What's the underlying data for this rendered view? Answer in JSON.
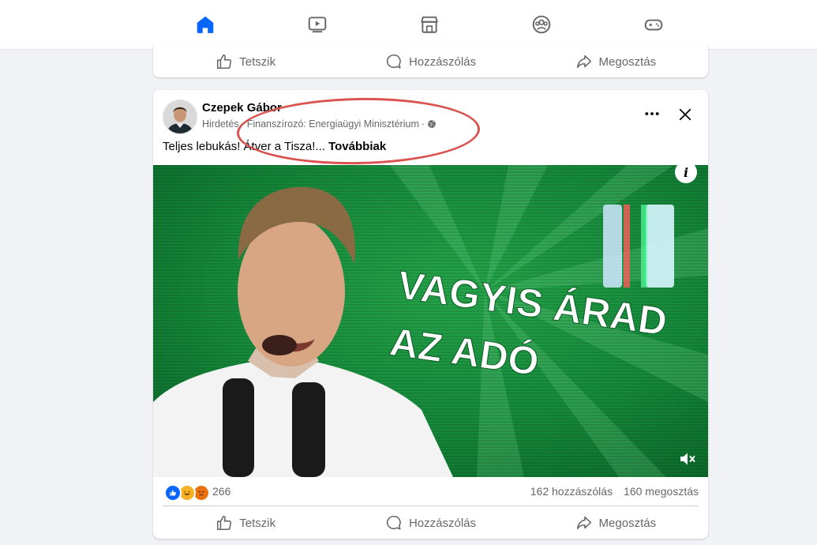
{
  "nav": {
    "tabs": [
      {
        "name": "home-icon",
        "active": true
      },
      {
        "name": "video-icon",
        "active": false
      },
      {
        "name": "marketplace-icon",
        "active": false
      },
      {
        "name": "groups-icon",
        "active": false
      },
      {
        "name": "gaming-icon",
        "active": false
      }
    ],
    "accent_color": "#0866ff"
  },
  "prev_post": {
    "like_label": "Tetszik",
    "comment_label": "Hozzászólás",
    "share_label": "Megosztás"
  },
  "post": {
    "author": "Czepek Gábor",
    "sponsored": "Hirdetés",
    "meta_sep": "·",
    "funding": "Finanszírozó: Energiaügyi Minisztérium",
    "meta_sep2": "·",
    "text": "Teljes lebukás! Átver a Tisza!...",
    "see_more": "Továbbiak",
    "media": {
      "headline_line1": "VAGYIS ÁRAD",
      "headline_line2": "AZ ADÓ",
      "info_label": "i"
    },
    "reactions": [
      "like",
      "haha",
      "angry"
    ],
    "reaction_count": "266",
    "comments": "162 hozzászólás",
    "shares": "160 megosztás",
    "like_label": "Tetszik",
    "comment_label": "Hozzászólás",
    "share_label": "Megosztás"
  },
  "annotation": {
    "color": "#d9534f"
  }
}
